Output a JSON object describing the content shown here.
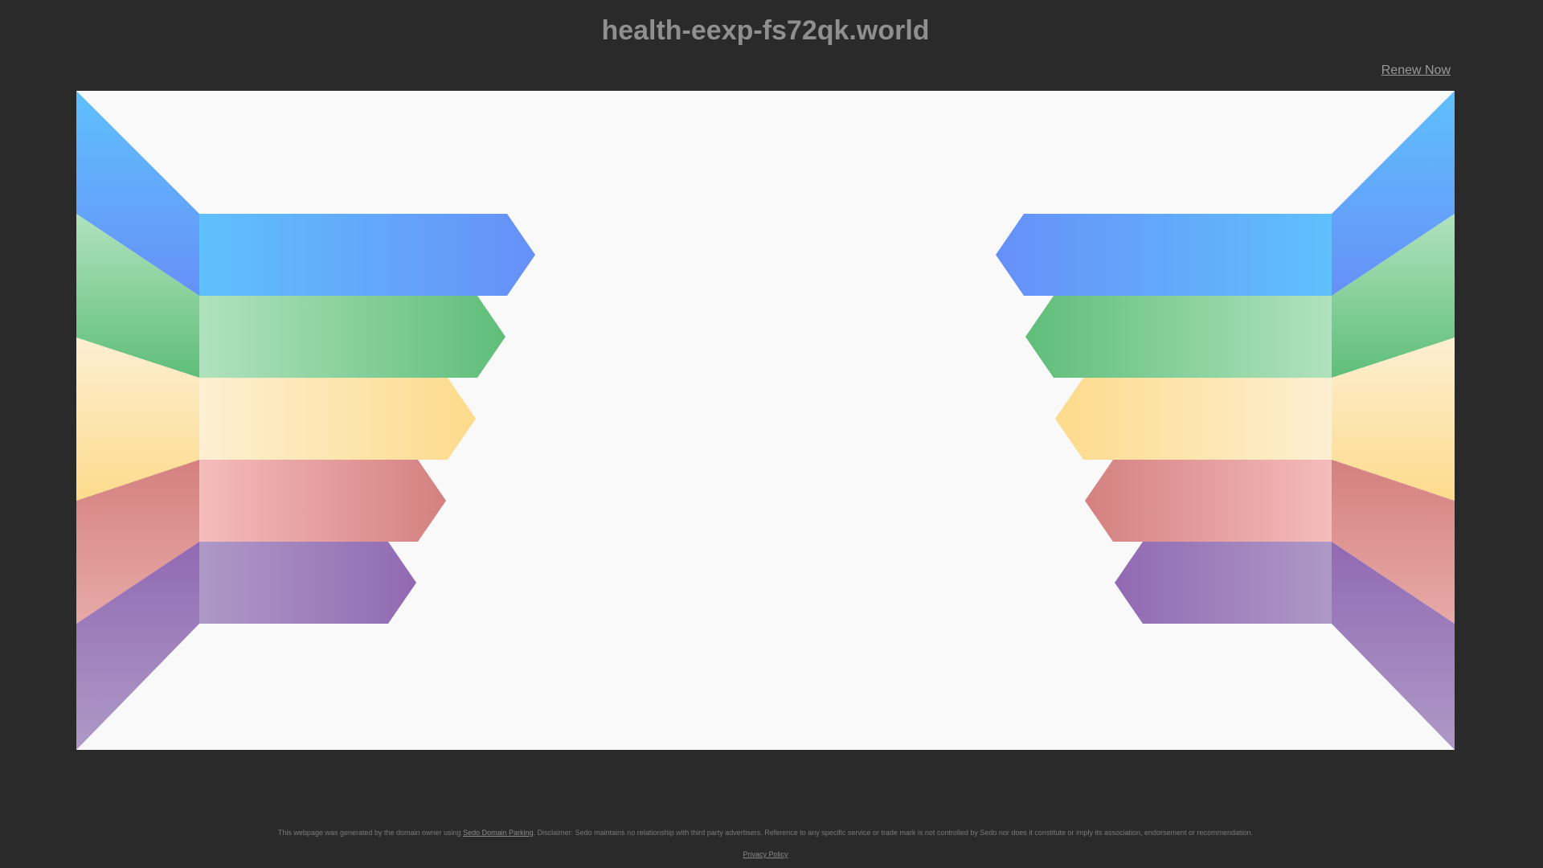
{
  "header": {
    "domain": "health-eexp-fs72qk.world",
    "renew_label": "Renew Now"
  },
  "banner": {
    "colors": {
      "blue_a": "#5fc0fc",
      "blue_b": "#6690f8",
      "green_a": "#b0e2bd",
      "green_b": "#5fbe79",
      "yellow_a": "#fdefd2",
      "yellow_b": "#fddb8c",
      "red_a": "#f5bcbc",
      "red_b": "#d48080",
      "purple_a": "#ae99c6",
      "purple_b": "#9169b3",
      "background": "#f9f9f9"
    }
  },
  "footer": {
    "text_before": "This webpage was generated by the domain owner using ",
    "link_label": "Sedo Domain Parking",
    "text_after": ". Disclaimer: Sedo maintains no relationship with third party advertisers. Reference to any specific service or trade mark is not controlled by Sedo nor does it constitute or imply its association, endorsement or recommendation.",
    "privacy_label": "Privacy Policy"
  }
}
